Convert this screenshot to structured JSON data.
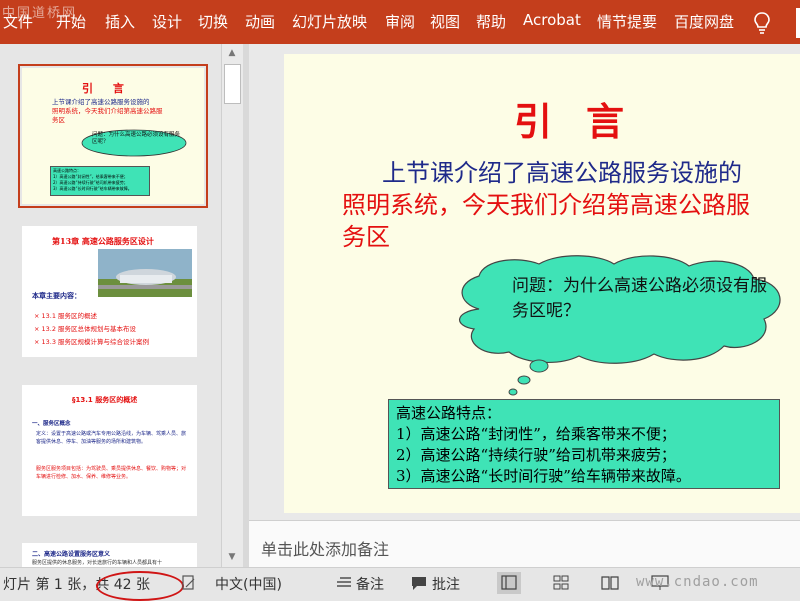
{
  "watermark": "中国道桥网",
  "ribbon": {
    "tabs": [
      "文件",
      "开始",
      "插入",
      "设计",
      "切换",
      "动画",
      "幻灯片放映",
      "审阅",
      "视图",
      "帮助",
      "Acrobat",
      "情节提要",
      "百度网盘"
    ],
    "bulb_icon": "lightbulb-icon",
    "color": "#c43e1c"
  },
  "thumbnails": [
    {
      "title": "引  言",
      "line1": "上节课介绍了高速公路服务设施的",
      "line2a": "照明系统，今天我们介绍第",
      "line2b": "高速公路服",
      "line3": "务区",
      "cloud": "问题：为什么高速公路必须设有服务区呢？",
      "box": [
        "高速公路特点：",
        "1）高速公路“封闭性”，给乘客带来不便；",
        "2）高速公路“持续行驶”给司机带来疲劳；",
        "3）高速公路“长时间行驶”给车辆带来故障。"
      ]
    },
    {
      "title": "第13章  高速公路服务区设计",
      "heading": "本章主要内容：",
      "items": [
        "× 13.1  服务区的概述",
        "× 13.2  服务区总体规划与基本布设",
        "× 13.3  服务区规模计算与综合设计案例"
      ]
    },
    {
      "title": "§13.1  服务区的概述",
      "sub": "一、服务区概念",
      "para1": "定义：设置于高速公路或汽车专用公路沿线，为车辆、驾乘人员、旅客提供休息、停车、加油等服务的场所和建筑物。",
      "para2": "服务区服务项目包括：为驾驶员、乘员提供休息、餐饮、购物等；对车辆进行检修、加水、保养、维修等业务。"
    },
    {
      "title": "二、高速公路设置服务区意义",
      "para": "服务区提供的休息服务，对长途旅行的车辆和人员都具有十"
    }
  ],
  "slide": {
    "title": "引言",
    "body_part1": "上节课介绍了高速公路服务设施的",
    "body_part2": "照明系统，今天我们介绍第",
    "body_highlight": "高速公路服",
    "body_part3": "务区",
    "cloud_text": "问题：为什么高速公路必须设有服务区呢？",
    "features": [
      "高速公路特点：",
      "1）高速公路“封闭性”，给乘客带来不便；",
      "2）高速公路“持续行驶”给司机带来疲劳；",
      "3）高速公路“长时间行驶”给车辆带来故障。"
    ],
    "accent_color": "#e41010",
    "box_color": "#3fe3b6"
  },
  "notes_placeholder": "单击此处添加备注",
  "status": {
    "slide_counter": "灯片 第 1 张，共 42 张",
    "language": "中文(中国)",
    "notes_label": "备注",
    "comments_label": "批注",
    "watermark": "www.cndao.com"
  }
}
